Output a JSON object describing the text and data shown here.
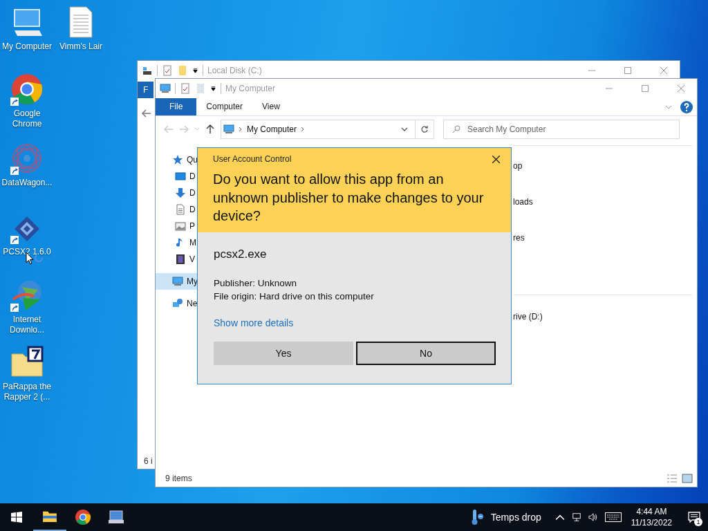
{
  "desktop_icons": [
    {
      "label": "My Computer",
      "kind": "computer",
      "shortcut": false
    },
    {
      "label": "Vimm's Lair",
      "kind": "document",
      "shortcut": false
    },
    {
      "label": "Google Chrome",
      "kind": "chrome",
      "shortcut": true
    },
    {
      "label": "DataWagon...",
      "kind": "mandala",
      "shortcut": true
    },
    {
      "label": "PCSX2 1.6.0",
      "kind": "gamepad-logo",
      "shortcut": true
    },
    {
      "label": "Internet Downlo...",
      "kind": "globe",
      "shortcut": true
    },
    {
      "label": "PaRappa the Rapper 2 (...",
      "kind": "archive",
      "shortcut": false
    }
  ],
  "back_window": {
    "title": "Local Disk (C:)",
    "ribbon_tab": "F",
    "status": "6 i"
  },
  "front_window": {
    "title": "My Computer",
    "ribbon_tabs": [
      {
        "label": "File",
        "selected": true
      },
      {
        "label": "Computer",
        "selected": false
      },
      {
        "label": "View",
        "selected": false
      }
    ],
    "address": "My Computer",
    "search": {
      "placeholder": "Search My Computer"
    },
    "nav": [
      {
        "label": "Qu",
        "kind": "star",
        "selected": false,
        "children": [
          {
            "label": "D",
            "kind": "desktop",
            "selected": false
          },
          {
            "label": "D",
            "kind": "download",
            "selected": false
          },
          {
            "label": "D",
            "kind": "document",
            "selected": false
          },
          {
            "label": "P",
            "kind": "picture",
            "selected": false
          },
          {
            "label": "M",
            "kind": "music",
            "selected": false
          },
          {
            "label": "V",
            "kind": "video",
            "selected": false
          }
        ]
      },
      {
        "label": "My",
        "kind": "computer",
        "selected": true
      },
      {
        "label": "Ne",
        "kind": "network",
        "selected": false
      }
    ],
    "content_groups": [
      {
        "items": [
          "op",
          "loads",
          "res"
        ]
      },
      {
        "items": [
          "rive (D:)"
        ]
      }
    ],
    "status": "9 items"
  },
  "dialog": {
    "title": "User Account Control",
    "question": "Do you want to allow this app from an unknown publisher to make changes to your device?",
    "program": "pcsx2.exe",
    "details": [
      "Publisher: Unknown",
      "File origin: Hard drive on this computer"
    ],
    "link": "Show more details",
    "buttons": [
      {
        "label": "Yes",
        "focused": false
      },
      {
        "label": "No",
        "focused": true
      }
    ]
  },
  "taskbar": {
    "apps": [
      {
        "kind": "folder",
        "running": true
      },
      {
        "kind": "chrome",
        "running": false
      },
      {
        "kind": "monitor",
        "running": false
      }
    ],
    "weather": "Temps drop",
    "time": "4:44 AM",
    "date": "11/13/2022",
    "notifications": "1"
  }
}
